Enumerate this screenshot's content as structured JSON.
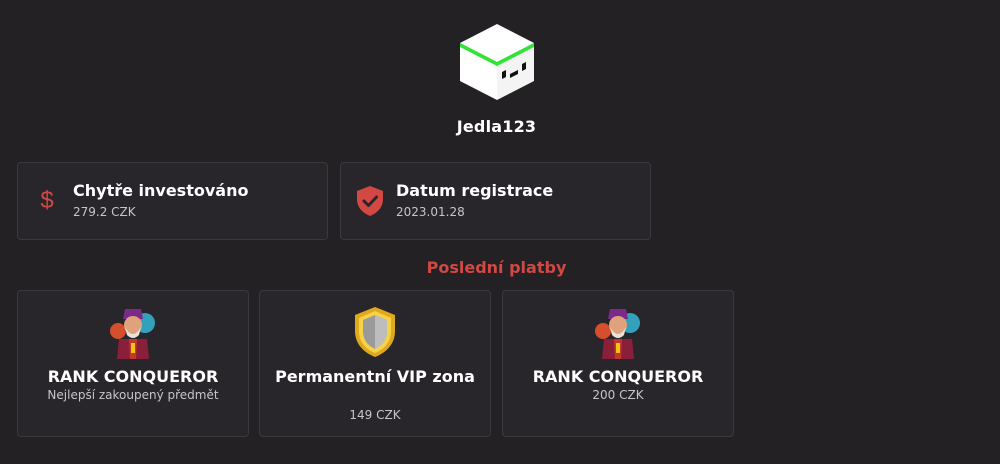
{
  "profile": {
    "username": "Jedla123",
    "avatar_icon": "minecraft-head-icon"
  },
  "stats": [
    {
      "title": "Chytře investováno",
      "value": "279.2 CZK",
      "icon": "dollar-icon"
    },
    {
      "title": "Datum registrace",
      "value": "2023.01.28",
      "icon": "shield-check-icon"
    }
  ],
  "payments": {
    "title": "Poslední platby",
    "items": [
      {
        "name": "RANK CONQUEROR",
        "sub": "Nejlepší zakoupený předmět",
        "icon": "wizard-icon"
      },
      {
        "name": "Permanentní VIP zona",
        "sub": "149 CZK",
        "icon": "gold-shield-icon"
      },
      {
        "name": "RANK CONQUEROR",
        "sub": "200 CZK",
        "icon": "wizard-icon"
      }
    ]
  },
  "colors": {
    "background": "#232124",
    "card": "#28262b",
    "accent_red": "#d24843",
    "avatar_green": "#2ee533"
  }
}
